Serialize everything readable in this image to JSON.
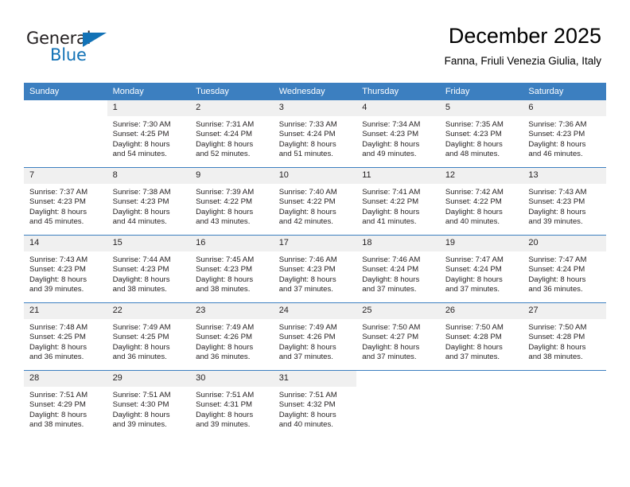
{
  "logo": {
    "word1": "General",
    "word2": "Blue",
    "triangle_color": "#1272b6",
    "text_color": "#231f20"
  },
  "header": {
    "title": "December 2025",
    "subtitle": "Fanna, Friuli Venezia Giulia, Italy"
  },
  "colors": {
    "header_blue": "#3c7fc0",
    "daynum_band": "#f0f0f0",
    "text": "#231f20"
  },
  "weekdays": [
    "Sunday",
    "Monday",
    "Tuesday",
    "Wednesday",
    "Thursday",
    "Friday",
    "Saturday"
  ],
  "weeks": [
    [
      {
        "day": "",
        "sunrise": "",
        "sunset": "",
        "daylight1": "",
        "daylight2": "",
        "blank": true
      },
      {
        "day": "1",
        "sunrise": "Sunrise: 7:30 AM",
        "sunset": "Sunset: 4:25 PM",
        "daylight1": "Daylight: 8 hours",
        "daylight2": "and 54 minutes."
      },
      {
        "day": "2",
        "sunrise": "Sunrise: 7:31 AM",
        "sunset": "Sunset: 4:24 PM",
        "daylight1": "Daylight: 8 hours",
        "daylight2": "and 52 minutes."
      },
      {
        "day": "3",
        "sunrise": "Sunrise: 7:33 AM",
        "sunset": "Sunset: 4:24 PM",
        "daylight1": "Daylight: 8 hours",
        "daylight2": "and 51 minutes."
      },
      {
        "day": "4",
        "sunrise": "Sunrise: 7:34 AM",
        "sunset": "Sunset: 4:23 PM",
        "daylight1": "Daylight: 8 hours",
        "daylight2": "and 49 minutes."
      },
      {
        "day": "5",
        "sunrise": "Sunrise: 7:35 AM",
        "sunset": "Sunset: 4:23 PM",
        "daylight1": "Daylight: 8 hours",
        "daylight2": "and 48 minutes."
      },
      {
        "day": "6",
        "sunrise": "Sunrise: 7:36 AM",
        "sunset": "Sunset: 4:23 PM",
        "daylight1": "Daylight: 8 hours",
        "daylight2": "and 46 minutes."
      }
    ],
    [
      {
        "day": "7",
        "sunrise": "Sunrise: 7:37 AM",
        "sunset": "Sunset: 4:23 PM",
        "daylight1": "Daylight: 8 hours",
        "daylight2": "and 45 minutes."
      },
      {
        "day": "8",
        "sunrise": "Sunrise: 7:38 AM",
        "sunset": "Sunset: 4:23 PM",
        "daylight1": "Daylight: 8 hours",
        "daylight2": "and 44 minutes."
      },
      {
        "day": "9",
        "sunrise": "Sunrise: 7:39 AM",
        "sunset": "Sunset: 4:22 PM",
        "daylight1": "Daylight: 8 hours",
        "daylight2": "and 43 minutes."
      },
      {
        "day": "10",
        "sunrise": "Sunrise: 7:40 AM",
        "sunset": "Sunset: 4:22 PM",
        "daylight1": "Daylight: 8 hours",
        "daylight2": "and 42 minutes."
      },
      {
        "day": "11",
        "sunrise": "Sunrise: 7:41 AM",
        "sunset": "Sunset: 4:22 PM",
        "daylight1": "Daylight: 8 hours",
        "daylight2": "and 41 minutes."
      },
      {
        "day": "12",
        "sunrise": "Sunrise: 7:42 AM",
        "sunset": "Sunset: 4:22 PM",
        "daylight1": "Daylight: 8 hours",
        "daylight2": "and 40 minutes."
      },
      {
        "day": "13",
        "sunrise": "Sunrise: 7:43 AM",
        "sunset": "Sunset: 4:23 PM",
        "daylight1": "Daylight: 8 hours",
        "daylight2": "and 39 minutes."
      }
    ],
    [
      {
        "day": "14",
        "sunrise": "Sunrise: 7:43 AM",
        "sunset": "Sunset: 4:23 PM",
        "daylight1": "Daylight: 8 hours",
        "daylight2": "and 39 minutes."
      },
      {
        "day": "15",
        "sunrise": "Sunrise: 7:44 AM",
        "sunset": "Sunset: 4:23 PM",
        "daylight1": "Daylight: 8 hours",
        "daylight2": "and 38 minutes."
      },
      {
        "day": "16",
        "sunrise": "Sunrise: 7:45 AM",
        "sunset": "Sunset: 4:23 PM",
        "daylight1": "Daylight: 8 hours",
        "daylight2": "and 38 minutes."
      },
      {
        "day": "17",
        "sunrise": "Sunrise: 7:46 AM",
        "sunset": "Sunset: 4:23 PM",
        "daylight1": "Daylight: 8 hours",
        "daylight2": "and 37 minutes."
      },
      {
        "day": "18",
        "sunrise": "Sunrise: 7:46 AM",
        "sunset": "Sunset: 4:24 PM",
        "daylight1": "Daylight: 8 hours",
        "daylight2": "and 37 minutes."
      },
      {
        "day": "19",
        "sunrise": "Sunrise: 7:47 AM",
        "sunset": "Sunset: 4:24 PM",
        "daylight1": "Daylight: 8 hours",
        "daylight2": "and 37 minutes."
      },
      {
        "day": "20",
        "sunrise": "Sunrise: 7:47 AM",
        "sunset": "Sunset: 4:24 PM",
        "daylight1": "Daylight: 8 hours",
        "daylight2": "and 36 minutes."
      }
    ],
    [
      {
        "day": "21",
        "sunrise": "Sunrise: 7:48 AM",
        "sunset": "Sunset: 4:25 PM",
        "daylight1": "Daylight: 8 hours",
        "daylight2": "and 36 minutes."
      },
      {
        "day": "22",
        "sunrise": "Sunrise: 7:49 AM",
        "sunset": "Sunset: 4:25 PM",
        "daylight1": "Daylight: 8 hours",
        "daylight2": "and 36 minutes."
      },
      {
        "day": "23",
        "sunrise": "Sunrise: 7:49 AM",
        "sunset": "Sunset: 4:26 PM",
        "daylight1": "Daylight: 8 hours",
        "daylight2": "and 36 minutes."
      },
      {
        "day": "24",
        "sunrise": "Sunrise: 7:49 AM",
        "sunset": "Sunset: 4:26 PM",
        "daylight1": "Daylight: 8 hours",
        "daylight2": "and 37 minutes."
      },
      {
        "day": "25",
        "sunrise": "Sunrise: 7:50 AM",
        "sunset": "Sunset: 4:27 PM",
        "daylight1": "Daylight: 8 hours",
        "daylight2": "and 37 minutes."
      },
      {
        "day": "26",
        "sunrise": "Sunrise: 7:50 AM",
        "sunset": "Sunset: 4:28 PM",
        "daylight1": "Daylight: 8 hours",
        "daylight2": "and 37 minutes."
      },
      {
        "day": "27",
        "sunrise": "Sunrise: 7:50 AM",
        "sunset": "Sunset: 4:28 PM",
        "daylight1": "Daylight: 8 hours",
        "daylight2": "and 38 minutes."
      }
    ],
    [
      {
        "day": "28",
        "sunrise": "Sunrise: 7:51 AM",
        "sunset": "Sunset: 4:29 PM",
        "daylight1": "Daylight: 8 hours",
        "daylight2": "and 38 minutes."
      },
      {
        "day": "29",
        "sunrise": "Sunrise: 7:51 AM",
        "sunset": "Sunset: 4:30 PM",
        "daylight1": "Daylight: 8 hours",
        "daylight2": "and 39 minutes."
      },
      {
        "day": "30",
        "sunrise": "Sunrise: 7:51 AM",
        "sunset": "Sunset: 4:31 PM",
        "daylight1": "Daylight: 8 hours",
        "daylight2": "and 39 minutes."
      },
      {
        "day": "31",
        "sunrise": "Sunrise: 7:51 AM",
        "sunset": "Sunset: 4:32 PM",
        "daylight1": "Daylight: 8 hours",
        "daylight2": "and 40 minutes."
      },
      {
        "day": "",
        "sunrise": "",
        "sunset": "",
        "daylight1": "",
        "daylight2": "",
        "blank": true
      },
      {
        "day": "",
        "sunrise": "",
        "sunset": "",
        "daylight1": "",
        "daylight2": "",
        "blank": true
      },
      {
        "day": "",
        "sunrise": "",
        "sunset": "",
        "daylight1": "",
        "daylight2": "",
        "blank": true
      }
    ]
  ]
}
